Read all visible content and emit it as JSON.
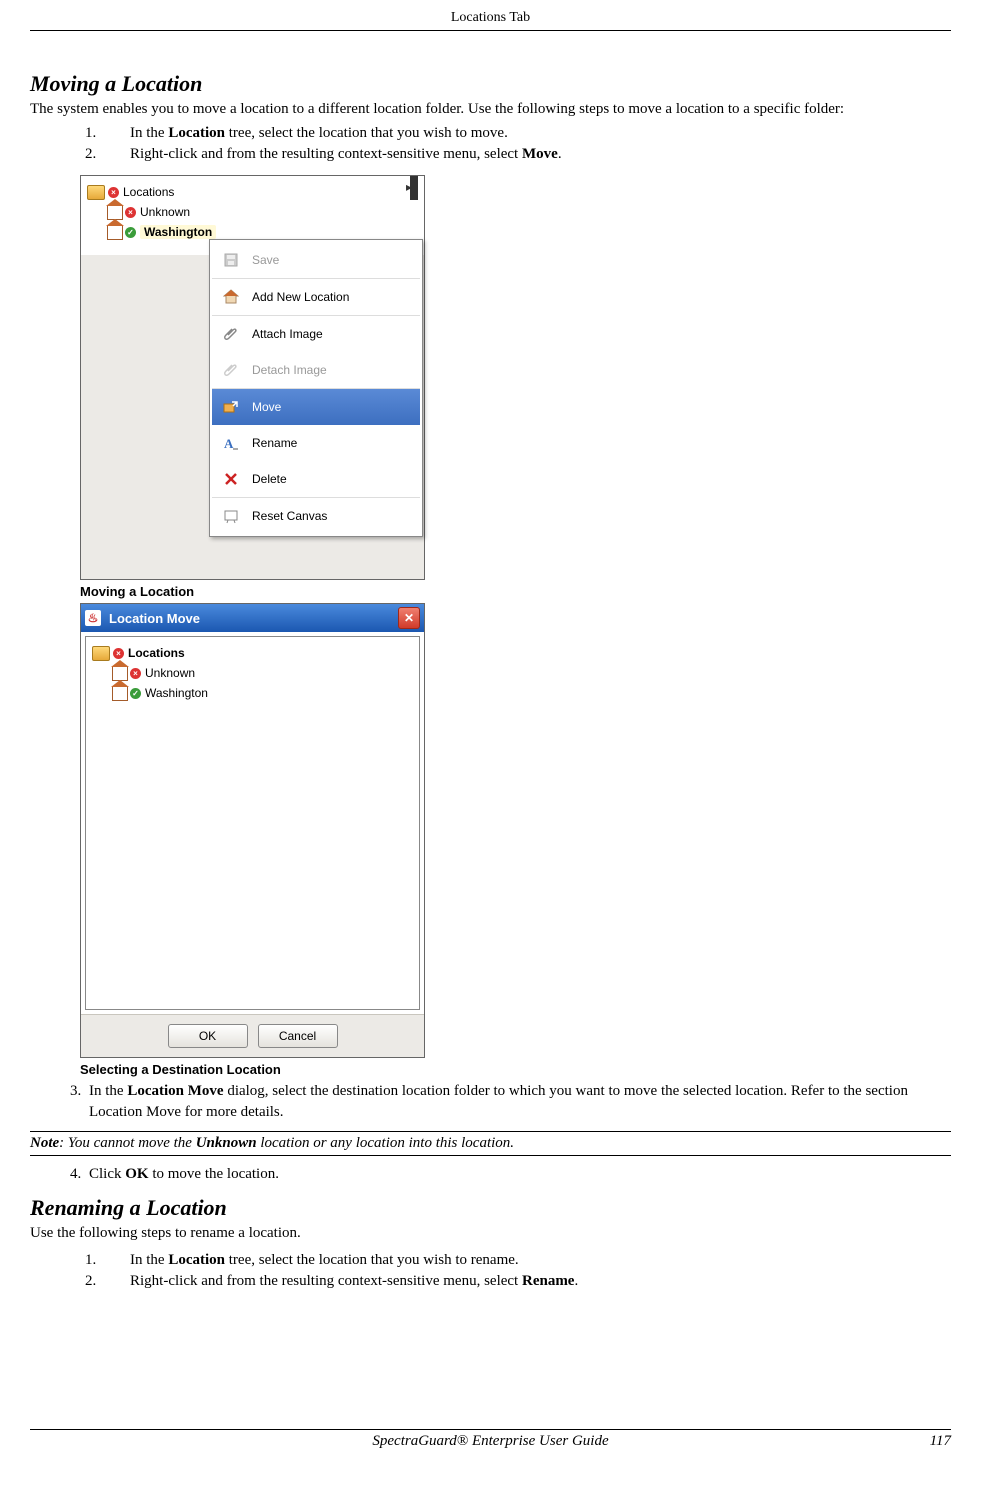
{
  "header": {
    "tab": "Locations Tab"
  },
  "section_moving": {
    "title": "Moving a Location",
    "intro_a": "The system enables you to move a location to a different location folder. Use the following steps to move a location to a specific folder:",
    "step1_a": "In the ",
    "step1_b": "Location",
    "step1_c": " tree, select the location that you wish to move.",
    "step2_a": "Right-click and from the resulting context-sensitive menu, select ",
    "step2_b": "Move",
    "step2_c": "."
  },
  "shot1": {
    "caption": "Moving a Location",
    "tree": {
      "root": "Locations",
      "unknown": "Unknown",
      "washington": "Washington"
    },
    "menu": {
      "save": "Save",
      "add_new_location": "Add New Location",
      "attach_image": "Attach Image",
      "detach_image": "Detach Image",
      "move": "Move",
      "rename": "Rename",
      "delete": "Delete",
      "reset_canvas": "Reset Canvas"
    }
  },
  "shot2": {
    "caption": "Selecting a Destination Location",
    "title": "Location Move",
    "tree": {
      "root": "Locations",
      "unknown": "Unknown",
      "washington": "Washington"
    },
    "ok": "OK",
    "cancel": "Cancel"
  },
  "step3": {
    "a": "In the ",
    "b": "Location Move",
    "c": " dialog, select the destination location folder to which you want to move the selected location. Refer to the section Location Move for more details."
  },
  "note": {
    "label": "Note",
    "a": ": You cannot move the ",
    "b": "Unknown",
    "c": " location or any location into this location."
  },
  "step4": {
    "a": "Click ",
    "b": "OK",
    "c": " to move the location."
  },
  "section_renaming": {
    "title": "Renaming a Location",
    "intro": "Use the following steps to rename a location.",
    "step1_a": "In the ",
    "step1_b": "Location",
    "step1_c": " tree, select the location that you wish to rename.",
    "step2_a": "Right-click and from the resulting context-sensitive menu, select ",
    "step2_b": "Rename",
    "step2_c": "."
  },
  "footer": {
    "title": "SpectraGuard® Enterprise User Guide",
    "page": "117"
  }
}
